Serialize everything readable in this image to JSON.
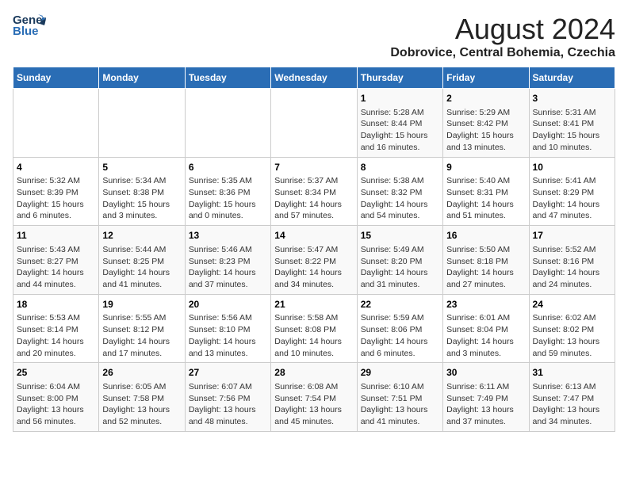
{
  "header": {
    "logo_line1": "General",
    "logo_line2": "Blue",
    "title": "August 2024",
    "subtitle": "Dobrovice, Central Bohemia, Czechia"
  },
  "weekdays": [
    "Sunday",
    "Monday",
    "Tuesday",
    "Wednesday",
    "Thursday",
    "Friday",
    "Saturday"
  ],
  "weeks": [
    [
      {
        "day": "",
        "info": ""
      },
      {
        "day": "",
        "info": ""
      },
      {
        "day": "",
        "info": ""
      },
      {
        "day": "",
        "info": ""
      },
      {
        "day": "1",
        "info": "Sunrise: 5:28 AM\nSunset: 8:44 PM\nDaylight: 15 hours\nand 16 minutes."
      },
      {
        "day": "2",
        "info": "Sunrise: 5:29 AM\nSunset: 8:42 PM\nDaylight: 15 hours\nand 13 minutes."
      },
      {
        "day": "3",
        "info": "Sunrise: 5:31 AM\nSunset: 8:41 PM\nDaylight: 15 hours\nand 10 minutes."
      }
    ],
    [
      {
        "day": "4",
        "info": "Sunrise: 5:32 AM\nSunset: 8:39 PM\nDaylight: 15 hours\nand 6 minutes."
      },
      {
        "day": "5",
        "info": "Sunrise: 5:34 AM\nSunset: 8:38 PM\nDaylight: 15 hours\nand 3 minutes."
      },
      {
        "day": "6",
        "info": "Sunrise: 5:35 AM\nSunset: 8:36 PM\nDaylight: 15 hours\nand 0 minutes."
      },
      {
        "day": "7",
        "info": "Sunrise: 5:37 AM\nSunset: 8:34 PM\nDaylight: 14 hours\nand 57 minutes."
      },
      {
        "day": "8",
        "info": "Sunrise: 5:38 AM\nSunset: 8:32 PM\nDaylight: 14 hours\nand 54 minutes."
      },
      {
        "day": "9",
        "info": "Sunrise: 5:40 AM\nSunset: 8:31 PM\nDaylight: 14 hours\nand 51 minutes."
      },
      {
        "day": "10",
        "info": "Sunrise: 5:41 AM\nSunset: 8:29 PM\nDaylight: 14 hours\nand 47 minutes."
      }
    ],
    [
      {
        "day": "11",
        "info": "Sunrise: 5:43 AM\nSunset: 8:27 PM\nDaylight: 14 hours\nand 44 minutes."
      },
      {
        "day": "12",
        "info": "Sunrise: 5:44 AM\nSunset: 8:25 PM\nDaylight: 14 hours\nand 41 minutes."
      },
      {
        "day": "13",
        "info": "Sunrise: 5:46 AM\nSunset: 8:23 PM\nDaylight: 14 hours\nand 37 minutes."
      },
      {
        "day": "14",
        "info": "Sunrise: 5:47 AM\nSunset: 8:22 PM\nDaylight: 14 hours\nand 34 minutes."
      },
      {
        "day": "15",
        "info": "Sunrise: 5:49 AM\nSunset: 8:20 PM\nDaylight: 14 hours\nand 31 minutes."
      },
      {
        "day": "16",
        "info": "Sunrise: 5:50 AM\nSunset: 8:18 PM\nDaylight: 14 hours\nand 27 minutes."
      },
      {
        "day": "17",
        "info": "Sunrise: 5:52 AM\nSunset: 8:16 PM\nDaylight: 14 hours\nand 24 minutes."
      }
    ],
    [
      {
        "day": "18",
        "info": "Sunrise: 5:53 AM\nSunset: 8:14 PM\nDaylight: 14 hours\nand 20 minutes."
      },
      {
        "day": "19",
        "info": "Sunrise: 5:55 AM\nSunset: 8:12 PM\nDaylight: 14 hours\nand 17 minutes."
      },
      {
        "day": "20",
        "info": "Sunrise: 5:56 AM\nSunset: 8:10 PM\nDaylight: 14 hours\nand 13 minutes."
      },
      {
        "day": "21",
        "info": "Sunrise: 5:58 AM\nSunset: 8:08 PM\nDaylight: 14 hours\nand 10 minutes."
      },
      {
        "day": "22",
        "info": "Sunrise: 5:59 AM\nSunset: 8:06 PM\nDaylight: 14 hours\nand 6 minutes."
      },
      {
        "day": "23",
        "info": "Sunrise: 6:01 AM\nSunset: 8:04 PM\nDaylight: 14 hours\nand 3 minutes."
      },
      {
        "day": "24",
        "info": "Sunrise: 6:02 AM\nSunset: 8:02 PM\nDaylight: 13 hours\nand 59 minutes."
      }
    ],
    [
      {
        "day": "25",
        "info": "Sunrise: 6:04 AM\nSunset: 8:00 PM\nDaylight: 13 hours\nand 56 minutes."
      },
      {
        "day": "26",
        "info": "Sunrise: 6:05 AM\nSunset: 7:58 PM\nDaylight: 13 hours\nand 52 minutes."
      },
      {
        "day": "27",
        "info": "Sunrise: 6:07 AM\nSunset: 7:56 PM\nDaylight: 13 hours\nand 48 minutes."
      },
      {
        "day": "28",
        "info": "Sunrise: 6:08 AM\nSunset: 7:54 PM\nDaylight: 13 hours\nand 45 minutes."
      },
      {
        "day": "29",
        "info": "Sunrise: 6:10 AM\nSunset: 7:51 PM\nDaylight: 13 hours\nand 41 minutes."
      },
      {
        "day": "30",
        "info": "Sunrise: 6:11 AM\nSunset: 7:49 PM\nDaylight: 13 hours\nand 37 minutes."
      },
      {
        "day": "31",
        "info": "Sunrise: 6:13 AM\nSunset: 7:47 PM\nDaylight: 13 hours\nand 34 minutes."
      }
    ]
  ]
}
